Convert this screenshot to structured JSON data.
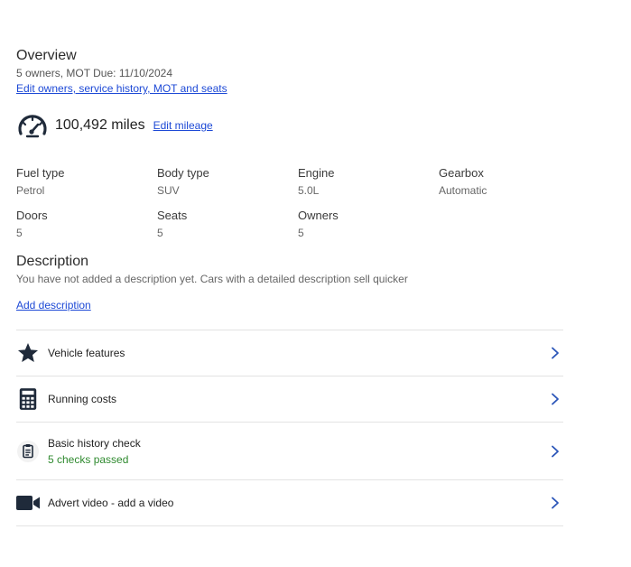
{
  "overview": {
    "title": "Overview",
    "meta": "5 owners, MOT Due: 11/10/2024",
    "edit_link": "Edit owners, service history, MOT and seats"
  },
  "mileage": {
    "value": "100,492 miles",
    "edit_link": "Edit mileage",
    "icon": "speedometer-icon"
  },
  "specs": [
    {
      "label": "Fuel type",
      "value": "Petrol"
    },
    {
      "label": "Body type",
      "value": "SUV"
    },
    {
      "label": "Engine",
      "value": "5.0L"
    },
    {
      "label": "Gearbox",
      "value": "Automatic"
    },
    {
      "label": "Doors",
      "value": "5"
    },
    {
      "label": "Seats",
      "value": "5"
    },
    {
      "label": "Owners",
      "value": "5"
    }
  ],
  "description": {
    "title": "Description",
    "text": "You have not added a description yet. Cars with a detailed description sell quicker",
    "add_link": "Add description"
  },
  "list": [
    {
      "title": "Vehicle features",
      "icon": "star-icon"
    },
    {
      "title": "Running costs",
      "icon": "calculator-icon"
    },
    {
      "title": "Basic history check",
      "subtitle": "5 checks passed",
      "icon": "clipboard-icon"
    },
    {
      "title": "Advert video - add a video",
      "icon": "video-camera-icon"
    }
  ],
  "colors": {
    "link": "#1d49d6",
    "success": "#2f8a2f",
    "chevron": "#2a55b8",
    "icon": "#1f2a3a"
  }
}
